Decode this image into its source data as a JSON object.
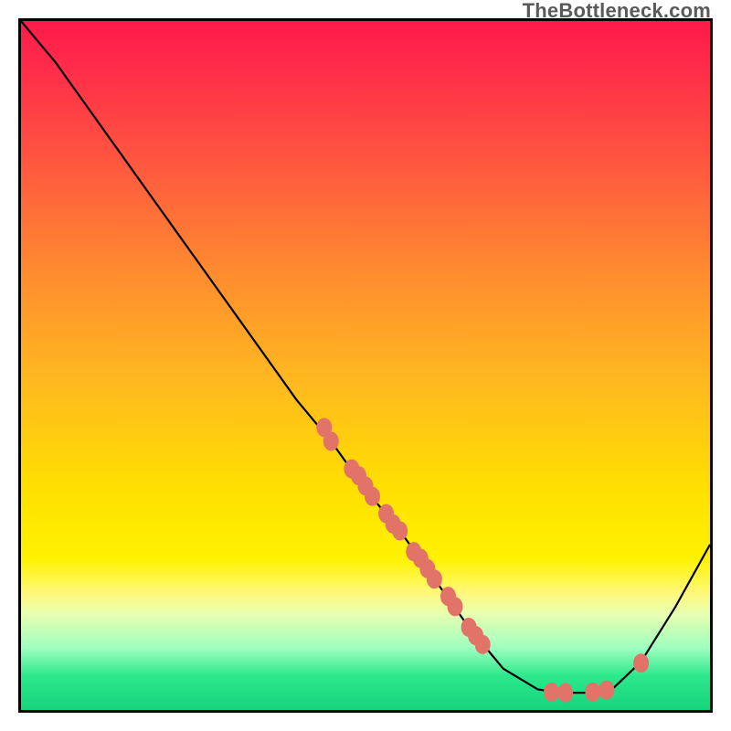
{
  "watermark": "TheBottleneck.com",
  "chart_data": {
    "type": "line",
    "title": "",
    "xlabel": "",
    "ylabel": "",
    "x_range": [
      0,
      100
    ],
    "y_range": [
      0,
      100
    ],
    "curve": [
      {
        "x": 0,
        "y": 100
      },
      {
        "x": 5,
        "y": 94
      },
      {
        "x": 10,
        "y": 87
      },
      {
        "x": 15,
        "y": 80
      },
      {
        "x": 20,
        "y": 73
      },
      {
        "x": 25,
        "y": 66
      },
      {
        "x": 30,
        "y": 59
      },
      {
        "x": 35,
        "y": 52
      },
      {
        "x": 40,
        "y": 45
      },
      {
        "x": 45,
        "y": 39
      },
      {
        "x": 50,
        "y": 32
      },
      {
        "x": 55,
        "y": 26
      },
      {
        "x": 60,
        "y": 19
      },
      {
        "x": 65,
        "y": 12
      },
      {
        "x": 70,
        "y": 6
      },
      {
        "x": 75,
        "y": 3
      },
      {
        "x": 78,
        "y": 2.5
      },
      {
        "x": 82,
        "y": 2.5
      },
      {
        "x": 86,
        "y": 3.2
      },
      {
        "x": 90,
        "y": 7
      },
      {
        "x": 95,
        "y": 15
      },
      {
        "x": 100,
        "y": 24
      }
    ],
    "points": [
      {
        "x": 44,
        "y": 41
      },
      {
        "x": 45,
        "y": 39
      },
      {
        "x": 48,
        "y": 35
      },
      {
        "x": 49,
        "y": 34
      },
      {
        "x": 50,
        "y": 32.5
      },
      {
        "x": 51,
        "y": 31
      },
      {
        "x": 53,
        "y": 28.5
      },
      {
        "x": 54,
        "y": 27
      },
      {
        "x": 55,
        "y": 26
      },
      {
        "x": 57,
        "y": 23
      },
      {
        "x": 58,
        "y": 22
      },
      {
        "x": 59,
        "y": 20.5
      },
      {
        "x": 60,
        "y": 19
      },
      {
        "x": 62,
        "y": 16.5
      },
      {
        "x": 63,
        "y": 15
      },
      {
        "x": 65,
        "y": 12
      },
      {
        "x": 66,
        "y": 10.8
      },
      {
        "x": 67,
        "y": 9.5
      },
      {
        "x": 77,
        "y": 2.6
      },
      {
        "x": 79,
        "y": 2.5
      },
      {
        "x": 83,
        "y": 2.6
      },
      {
        "x": 85,
        "y": 2.9
      },
      {
        "x": 90,
        "y": 6.8
      }
    ],
    "colors": {
      "curve": "#000000",
      "dot": "#e27368",
      "gradient_top": "#ff1a4a",
      "gradient_mid": "#ffe000",
      "gradient_bottom": "#15d47a"
    }
  }
}
